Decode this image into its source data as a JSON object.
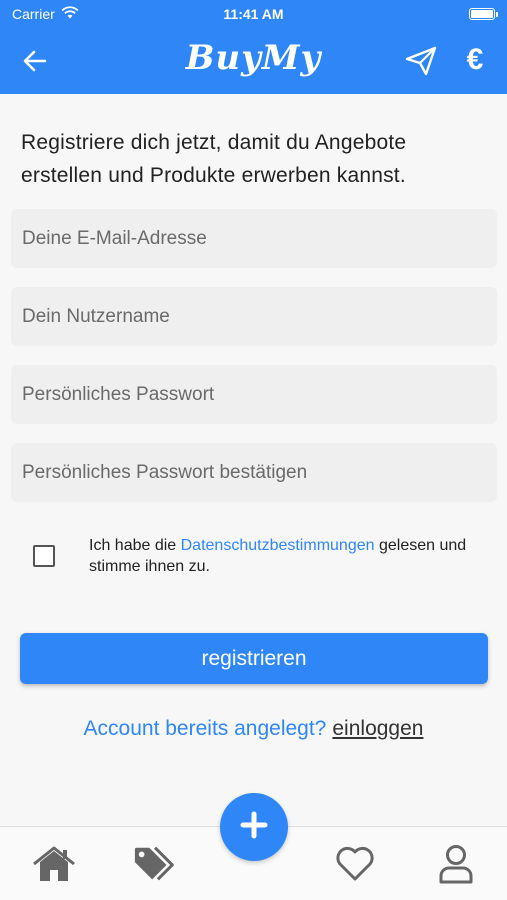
{
  "status_bar": {
    "carrier": "Carrier",
    "time": "11:41 AM"
  },
  "nav": {
    "title": "BuyMy",
    "euro_symbol": "€",
    "icons": [
      "back-arrow-icon",
      "send-icon",
      "euro-icon"
    ]
  },
  "intro_text": "Registriere dich jetzt, damit du Angebote erstellen und Produkte erwerben kannst.",
  "form": {
    "email_placeholder": "Deine E-Mail-Adresse",
    "email_value": "",
    "username_placeholder": "Dein Nutzername",
    "username_value": "",
    "password_placeholder": "Persönliches Passwort",
    "password_value": "",
    "password_confirm_placeholder": "Persönliches Passwort bestätigen",
    "password_confirm_value": ""
  },
  "consent": {
    "checked": false,
    "text_before": "Ich habe die ",
    "link_text": "Datenschutzbestimmungen",
    "text_after": " gelesen und stimme ihnen zu."
  },
  "register_button": "registrieren",
  "login": {
    "question": "Account bereits angelegt?",
    "link": "einloggen"
  },
  "tab_bar": {
    "icons": [
      "home-icon",
      "tags-icon",
      "add-icon",
      "heart-icon",
      "user-icon"
    ]
  },
  "colors": {
    "primary": "#2f86f6",
    "field_background": "#efefef",
    "page_background": "#f7f7f7",
    "tab_icon": "#666666"
  }
}
